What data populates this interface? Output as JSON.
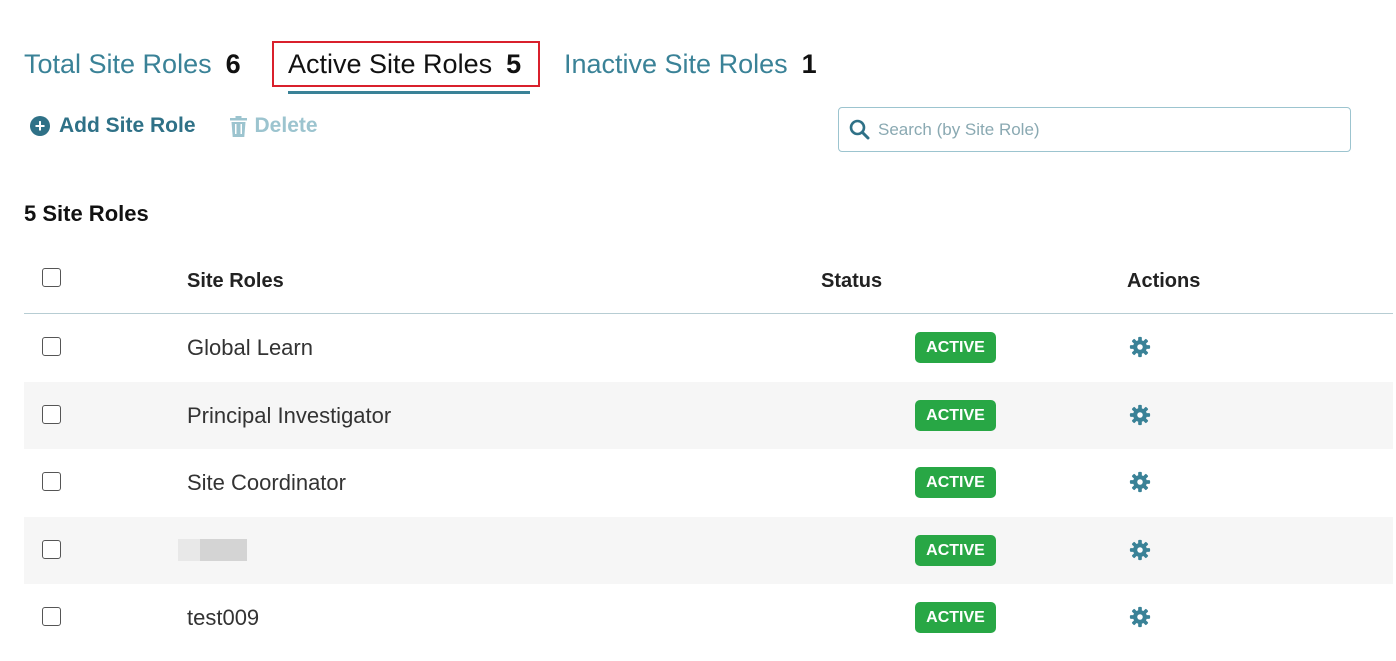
{
  "tabs": [
    {
      "label": "Total Site Roles",
      "count": "6"
    },
    {
      "label": "Active Site Roles",
      "count": "5"
    },
    {
      "label": "Inactive Site Roles",
      "count": "1"
    }
  ],
  "toolbar": {
    "add_label": "Add Site Role",
    "add_icon": "plus-circle-icon",
    "delete_label": "Delete",
    "delete_icon": "trash-icon"
  },
  "search": {
    "placeholder": "Search (by Site Role)",
    "value": "",
    "icon": "search-icon"
  },
  "list_title": "5 Site Roles",
  "table": {
    "columns": [
      "Site Roles",
      "Status",
      "Actions"
    ],
    "rows": [
      {
        "name": "Global Learn",
        "status": "ACTIVE"
      },
      {
        "name": "Principal Investigator",
        "status": "ACTIVE"
      },
      {
        "name": "Site Coordinator",
        "status": "ACTIVE"
      },
      {
        "name": "",
        "status": "ACTIVE"
      },
      {
        "name": "test009",
        "status": "ACTIVE"
      }
    ]
  },
  "colors": {
    "accent": "#3a8297",
    "active_badge": "#28a745",
    "selected_tab_border": "#d9202c"
  }
}
